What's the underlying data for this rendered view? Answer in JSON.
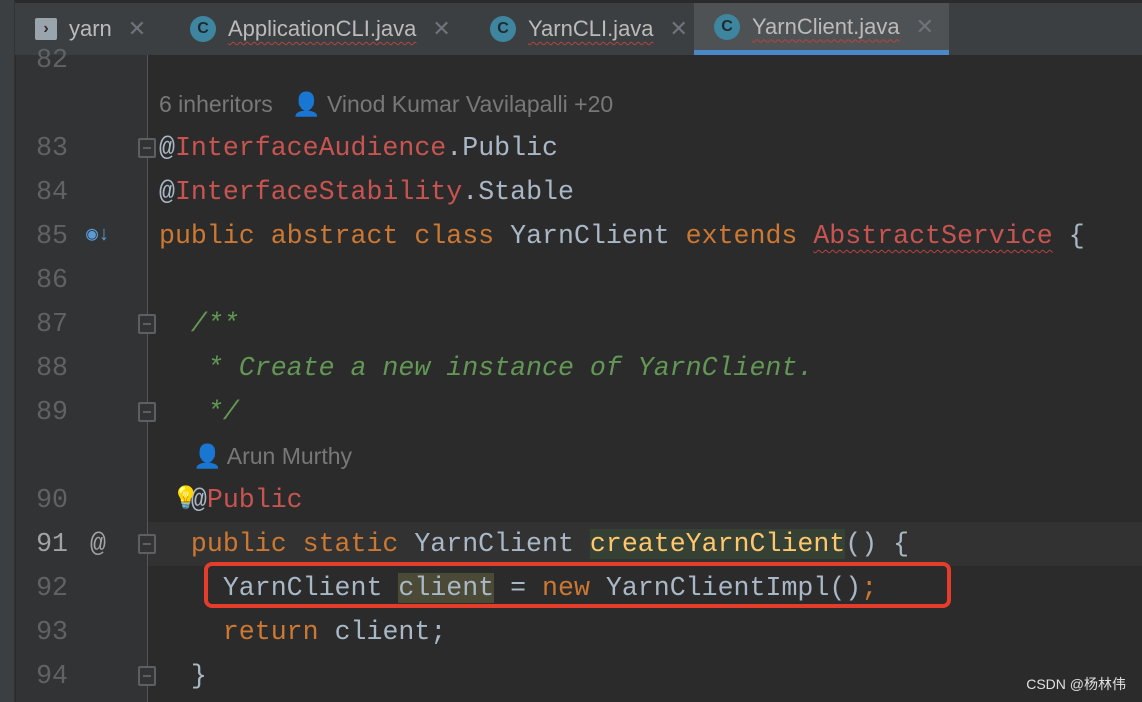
{
  "tabs": [
    {
      "label": "yarn",
      "icon": "terminal-icon",
      "active": false,
      "wavy": false
    },
    {
      "label": "ApplicationCLI.java",
      "icon": "class-run-icon",
      "active": false,
      "wavy": true
    },
    {
      "label": "YarnCLI.java",
      "icon": "abstract-class-icon",
      "active": false,
      "wavy": true
    },
    {
      "label": "YarnClient.java",
      "icon": "abstract-class-icon",
      "active": true,
      "wavy": true
    }
  ],
  "inlays": {
    "class_hint": "6 inheritors   👤 Vinod Kumar Vavilapalli +20",
    "method_hint": "👤 Arun Murthy"
  },
  "lines": [
    {
      "num": "82",
      "tokens": []
    },
    {
      "inlay": "class_hint"
    },
    {
      "num": "83",
      "tokens": [
        [
          "@",
          "p"
        ],
        [
          "InterfaceAudience",
          "annr"
        ],
        [
          ".Public",
          "p"
        ]
      ]
    },
    {
      "num": "84",
      "tokens": [
        [
          "@",
          "p"
        ],
        [
          "InterfaceStability",
          "annr"
        ],
        [
          ".Stable",
          "p"
        ]
      ]
    },
    {
      "num": "85",
      "tokens": [
        [
          "public abstract class ",
          "kw"
        ],
        [
          "YarnClient ",
          "p"
        ],
        [
          "extends ",
          "kw"
        ],
        [
          "AbstractService",
          "annr wavy"
        ],
        [
          " {",
          "p"
        ]
      ]
    },
    {
      "num": "86",
      "tokens": []
    },
    {
      "num": "87",
      "tokens": [
        [
          "  /**",
          "cm"
        ]
      ]
    },
    {
      "num": "88",
      "tokens": [
        [
          "   * Create a new instance of YarnClient.",
          "cm"
        ]
      ]
    },
    {
      "num": "89",
      "tokens": [
        [
          "   */",
          "cm"
        ]
      ]
    },
    {
      "inlay": "method_hint"
    },
    {
      "num": "90",
      "tokens": [
        [
          "  @",
          "p"
        ],
        [
          "Public",
          "annr"
        ]
      ]
    },
    {
      "num": "91",
      "current": true,
      "tokens": [
        [
          "  public static ",
          "kw"
        ],
        [
          "YarnClient ",
          "p"
        ],
        [
          "createYarnClient",
          "fn"
        ],
        [
          "() {",
          "p"
        ]
      ]
    },
    {
      "num": "92",
      "tokens": [
        [
          "    YarnClient ",
          "p"
        ],
        [
          "client",
          "hl"
        ],
        [
          " = ",
          "p"
        ],
        [
          "new ",
          "kw"
        ],
        [
          "YarnClientImpl()",
          "p"
        ],
        [
          ";",
          "kw"
        ]
      ]
    },
    {
      "num": "93",
      "tokens": [
        [
          "    return ",
          "kw"
        ],
        [
          "client;",
          "p"
        ]
      ]
    },
    {
      "num": "94",
      "tokens": [
        [
          "  }",
          "p"
        ]
      ]
    }
  ],
  "gutter_icons": {
    "85": "implemented-overridden-icon",
    "91": "at-annotation-icon",
    "90": "lightbulb-icon"
  },
  "watermark": "CSDN @杨林伟",
  "colors": {
    "keyword": "#cc7832",
    "annotation": "#c75450",
    "comment": "#629755",
    "method": "#ffc66d",
    "text": "#a9b7c6",
    "tab_accent": "#4a88c7",
    "highlight_box": "#e43d2b"
  }
}
